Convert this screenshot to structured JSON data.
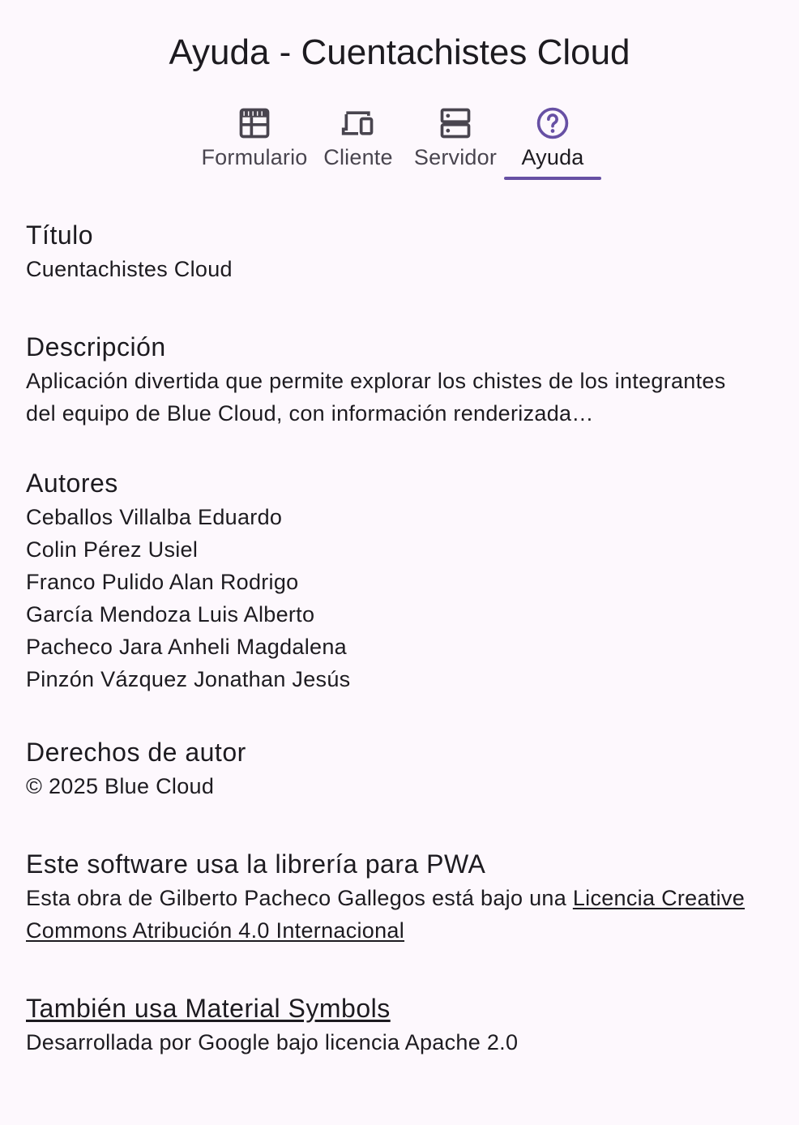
{
  "header": {
    "title": "Ayuda - Cuentachistes Cloud"
  },
  "tabs": [
    {
      "label": "Formulario",
      "icon": "table-form-icon",
      "active": false
    },
    {
      "label": "Cliente",
      "icon": "devices-icon",
      "active": false
    },
    {
      "label": "Servidor",
      "icon": "dns-server-icon",
      "active": false
    },
    {
      "label": "Ayuda",
      "icon": "help-circle-icon",
      "active": true
    }
  ],
  "colors": {
    "accent": "#6750a4",
    "background": "#fdf8fd",
    "text": "#1d1b20",
    "inactive_icon": "#49454f"
  },
  "sections": {
    "titulo": {
      "heading": "Título",
      "value": "Cuentachistes Cloud"
    },
    "descripcion": {
      "heading": "Descripción",
      "value": "Aplicación divertida que permite explorar los chistes de los integrantes del equipo de Blue Cloud, con información renderizada…"
    },
    "autores": {
      "heading": "Autores",
      "names": [
        "Ceballos Villalba Eduardo",
        "Colin Pérez Usiel",
        "Franco Pulido Alan Rodrigo",
        "García Mendoza Luis Alberto",
        "Pacheco Jara Anheli Magdalena",
        "Pinzón Vázquez Jonathan Jesús"
      ]
    },
    "derechos": {
      "heading": "Derechos de autor",
      "value": "© 2025 Blue Cloud"
    },
    "pwa": {
      "heading": "Este software usa la librería para PWA",
      "text_prefix": "Esta obra de Gilberto Pacheco Gallegos está bajo una ",
      "link_text": "Licencia Creative Commons Atribución 4.0 Internacional"
    },
    "material": {
      "heading_link": "También usa Material Symbols",
      "value": "Desarrollada por Google bajo licencia Apache 2.0"
    }
  }
}
